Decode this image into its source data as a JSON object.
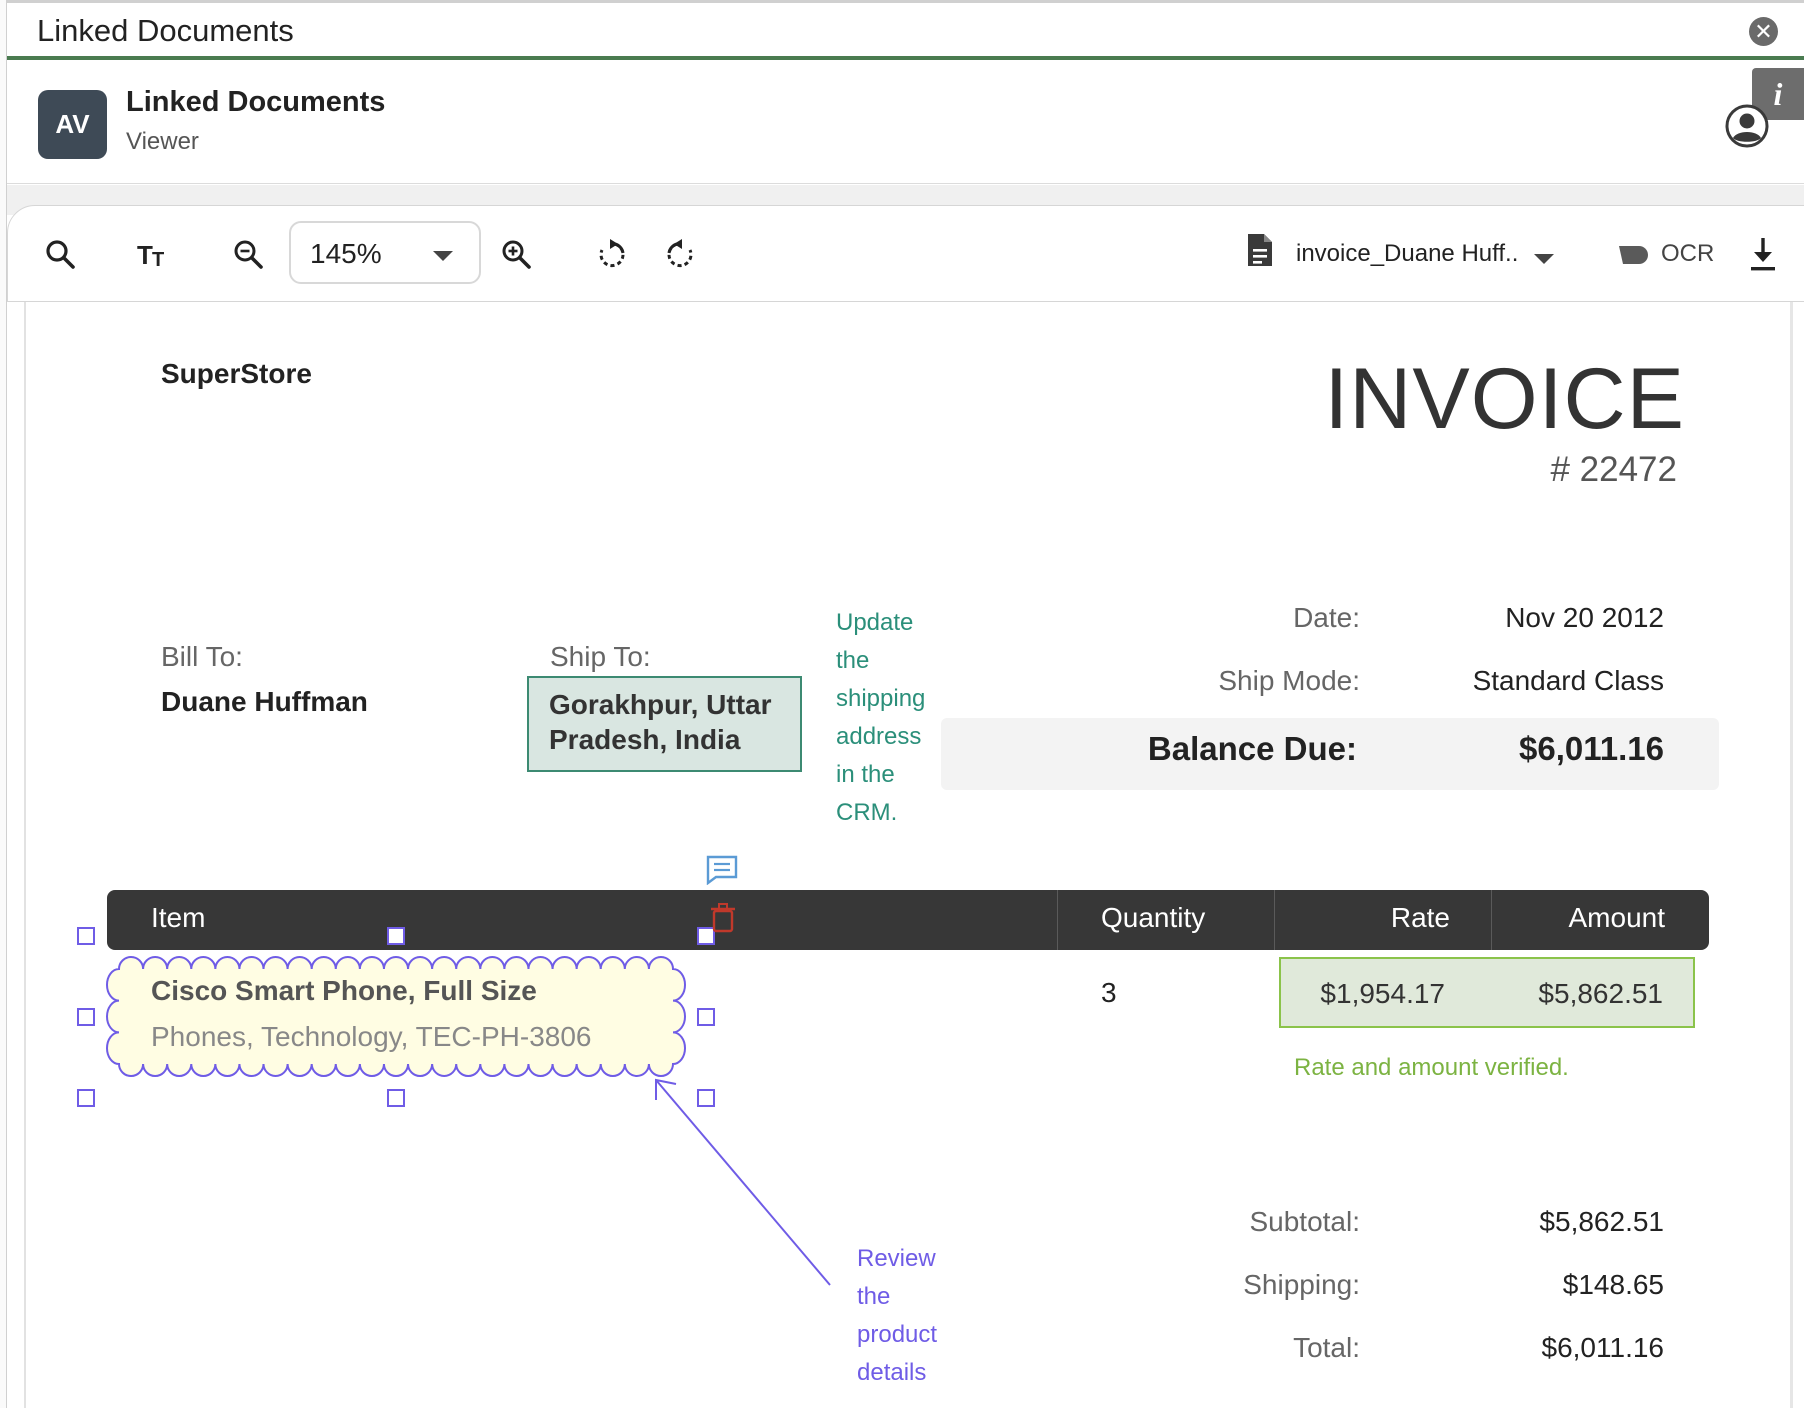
{
  "window": {
    "title": "Linked Documents",
    "close_icon": "close-icon"
  },
  "header": {
    "avatar_initials": "AV",
    "title": "Linked Documents",
    "subtitle": "Viewer",
    "info_label": "i"
  },
  "toolbar": {
    "icons": [
      "search-icon",
      "text-size-icon",
      "zoom-out-icon",
      "zoom-in-icon",
      "rotate-left-icon",
      "rotate-right-icon"
    ],
    "zoom_value": "145%",
    "document_name": "invoice_Duane Huff..",
    "ocr_label": "OCR",
    "colors": {
      "border": "#d6d6d6",
      "icon": "#222222"
    }
  },
  "invoice": {
    "company": "SuperStore",
    "title": "INVOICE",
    "number": "# 22472",
    "bill_to_label": "Bill To:",
    "bill_to_name": "Duane Huffman",
    "ship_to_label": "Ship To:",
    "ship_to_line1": "Gorakhpur, Uttar",
    "ship_to_line2": "Pradesh, India",
    "date_label": "Date:",
    "date_value": "Nov 20 2012",
    "ship_mode_label": "Ship Mode:",
    "ship_mode_value": "Standard Class",
    "balance_label": "Balance Due:",
    "balance_value": "$6,011.16",
    "table": {
      "headers": [
        "Item",
        "Quantity",
        "Rate",
        "Amount"
      ],
      "rows": [
        {
          "item": "Cisco Smart Phone, Full Size",
          "description": "Phones, Technology, TEC-PH-3806",
          "quantity": "3",
          "rate": "$1,954.17",
          "amount": "$5,862.51"
        }
      ]
    },
    "subtotal_label": "Subtotal:",
    "subtotal_value": "$5,862.51",
    "shipping_label": "Shipping:",
    "shipping_value": "$148.65",
    "total_label": "Total:",
    "total_value": "$6,011.16"
  },
  "annotations": {
    "crm_note": [
      "Update",
      "the",
      "shipping",
      "address",
      "in the",
      "CRM."
    ],
    "verified_note": "Rate and amount verified.",
    "product_note": [
      "Review",
      "the",
      "product",
      "details"
    ],
    "colors": {
      "crm": "#2b8f7a",
      "verified": "#7cb342",
      "product": "#6f5ce6",
      "cloud_fill": "#fffde3"
    }
  }
}
